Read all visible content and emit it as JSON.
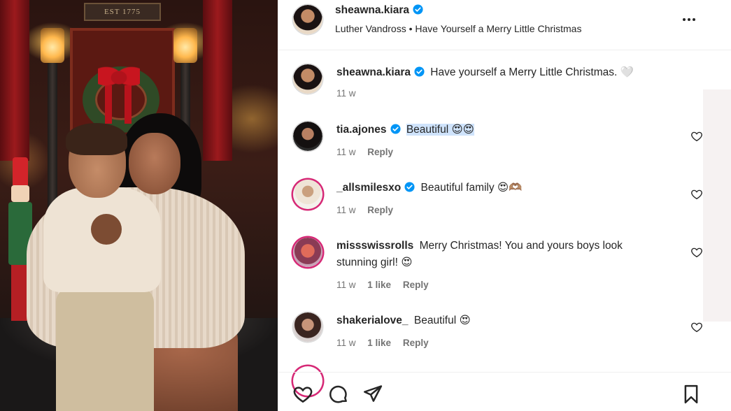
{
  "post_image": {
    "sign_text": "EST 1775"
  },
  "header": {
    "username": "sheawna.kiara",
    "music": "Luther Vandross • Have Yourself a Merry Little Christmas",
    "more_icon": "more-horizontal-icon"
  },
  "caption": {
    "username": "sheawna.kiara",
    "text": "Have yourself a Merry Little Christmas. 🤍",
    "time": "11 w"
  },
  "comments": [
    {
      "username": "tia.ajones",
      "verified": true,
      "text": "Beautiful 😍😍",
      "time": "11 w",
      "likes": "",
      "reply": "Reply"
    },
    {
      "username": "_allsmilesxo",
      "verified": true,
      "text": "Beautiful family 😍🫶🏽",
      "time": "11 w",
      "likes": "",
      "reply": "Reply"
    },
    {
      "username": "missswissrolls",
      "verified": false,
      "text": "Merry Christmas! You and yours boys look stunning girl! 😍",
      "time": "11 w",
      "likes": "1 like",
      "reply": "Reply"
    },
    {
      "username": "shakerialove_",
      "verified": false,
      "text": "Beautiful 😍",
      "time": "11 w",
      "likes": "1 like",
      "reply": "Reply"
    }
  ],
  "actions": {
    "like_icon": "heart-icon",
    "comment_icon": "comment-icon",
    "share_icon": "send-icon",
    "save_icon": "bookmark-icon"
  },
  "colors": {
    "verified": "#0095f6",
    "text": "#262626",
    "muted": "#737373",
    "highlight": "#cfe3fb",
    "story_ring": "#d62976"
  }
}
